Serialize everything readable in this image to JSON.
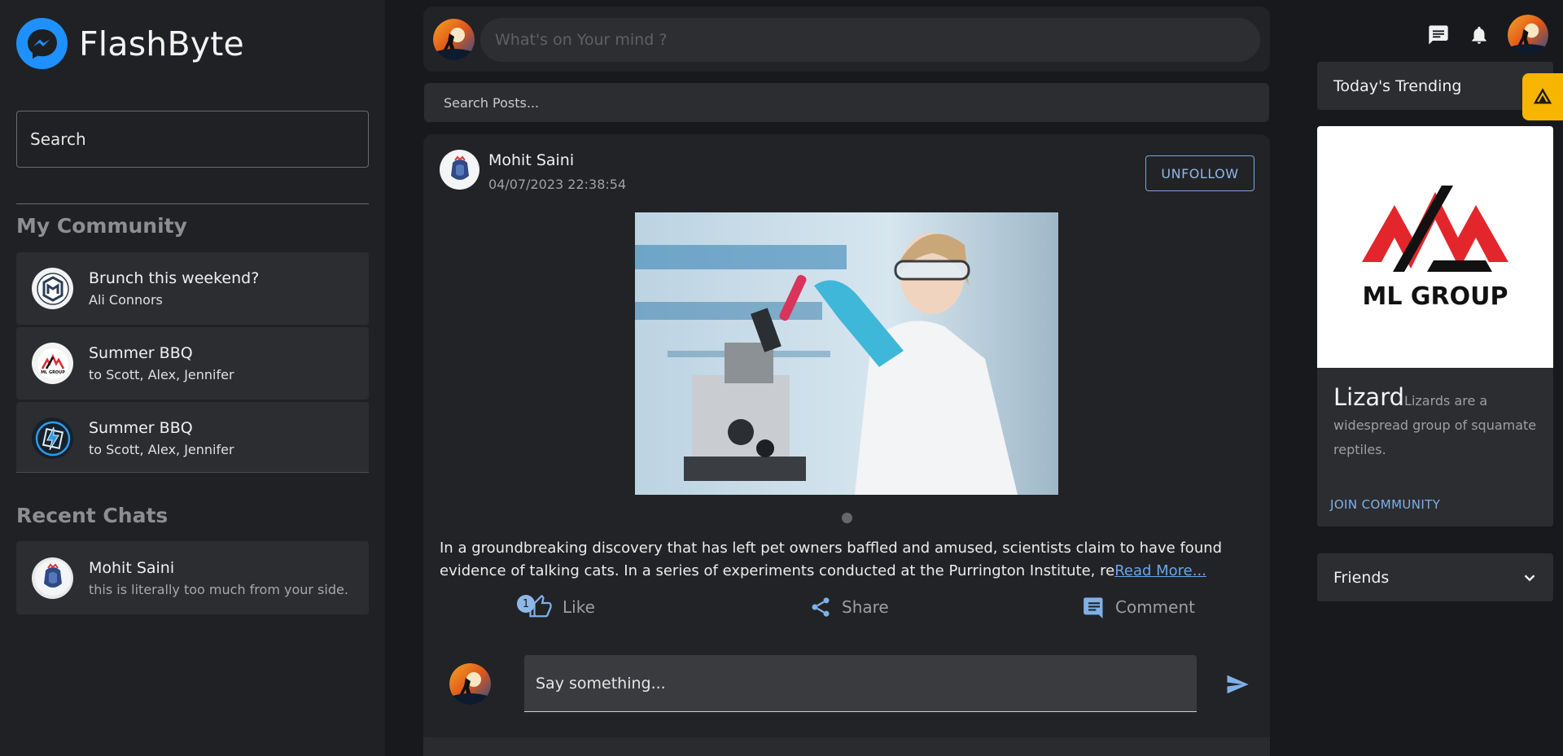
{
  "app": {
    "name": "FlashByte"
  },
  "left": {
    "search_placeholder": "Search",
    "community_title": "My Community",
    "communities": [
      {
        "title": "Brunch this weekend?",
        "subtitle": "Ali Connors",
        "icon": "mui-logo-icon"
      },
      {
        "title": "Summer BBQ",
        "subtitle": "to Scott, Alex, Jennifer",
        "icon": "ml-group-logo-icon"
      },
      {
        "title": "Summer BBQ",
        "subtitle": "to Scott, Alex, Jennifer",
        "icon": "lightning-logo-icon"
      }
    ],
    "recent_title": "Recent Chats",
    "recent_chats": [
      {
        "name": "Mohit Saini",
        "message": "this is literally too much from your side."
      }
    ]
  },
  "composer": {
    "placeholder": "What's on Your mind ?"
  },
  "search_posts": {
    "placeholder": "Search Posts..."
  },
  "post": {
    "author": "Mohit Saini",
    "timestamp": "04/07/2023 22:38:54",
    "follow_label": "UNFOLLOW",
    "text": "In a groundbreaking discovery that has left pet owners baffled and amused, scientists claim to have found evidence of talking cats. In a series of experiments conducted at the Purrington Institute, re",
    "read_more": "Read More...",
    "like_label": "Like",
    "like_count": "1",
    "share_label": "Share",
    "comment_label": "Comment",
    "comment_placeholder": "Say something..."
  },
  "right": {
    "trending_title": "Today's Trending",
    "community_card": {
      "logo_text": "ML GROUP",
      "name": "Lizard",
      "about": "Lizards are a widespread group of squamate reptiles.",
      "join_label": "JOIN COMMUNITY"
    },
    "friends_title": "Friends"
  },
  "colors": {
    "background": "#18191c",
    "panel": "#222326",
    "card": "#2c2d31",
    "accent": "#8fb8e6",
    "brand": "#1e90ff",
    "float_button": "#f7b500"
  }
}
